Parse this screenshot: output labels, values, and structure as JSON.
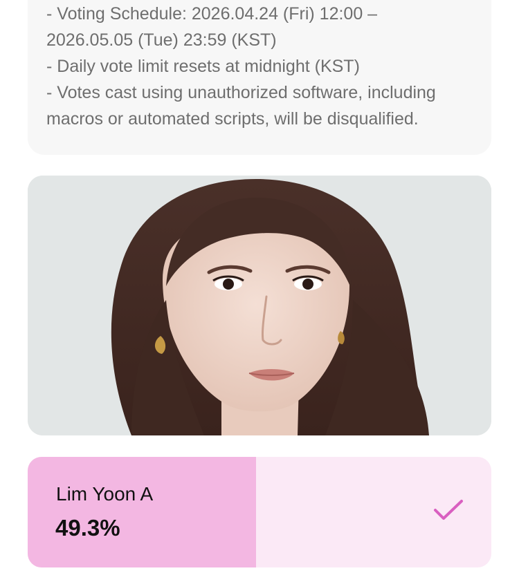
{
  "notice": {
    "lines": [
      "- Voting Schedule: 2026.04.24 (Fri) 12:00 –",
      "2026.05.05 (Tue) 23:59 (KST)",
      "- Daily vote limit resets at midnight (KST)",
      "- Votes cast using unauthorized software, including",
      "macros or automated scripts, will be disqualified."
    ]
  },
  "candidate": {
    "name": "Lim Yoon A",
    "percent_label": "49.3%",
    "vote_share": 0.493,
    "selected": true,
    "check_icon": "checkmark-icon"
  },
  "colors": {
    "notice_background": "#f7f7f7",
    "notice_text": "#6e6e6e",
    "bar_fill": "#f3b7e2",
    "bar_track": "#fbe9f6",
    "check_color": "#d95fc0"
  }
}
